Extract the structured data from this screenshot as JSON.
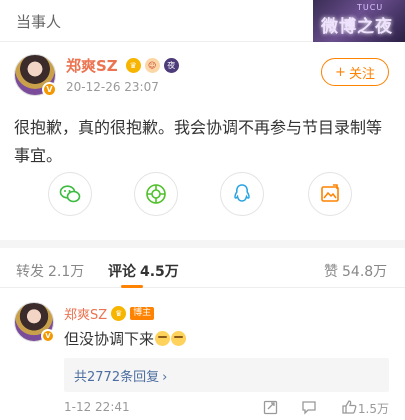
{
  "header": {
    "title": "当事人",
    "corner_small": "TUCU",
    "corner_big": "微博之夜"
  },
  "post": {
    "username": "郑爽SZ",
    "avatar_badge": "V",
    "tags": [
      "crown-icon",
      "face-icon",
      "night-icon"
    ],
    "night_tag": "夜",
    "timestamp": "20-12-26 23:07",
    "follow_label": "关注",
    "follow_plus": "+",
    "text": "很抱歉，真的很抱歉。我会协调不再参与节目录制等事宜。",
    "share_icons": [
      "wechat-icon",
      "moments-icon",
      "qq-icon",
      "image-share-icon"
    ]
  },
  "stats": {
    "repost_label": "转发",
    "repost_count": "2.1万",
    "comment_label": "评论",
    "comment_count": "4.5万",
    "like_label": "赞",
    "like_count": "54.8万"
  },
  "comment": {
    "username": "郑爽SZ",
    "author_badge": "博主",
    "text": "但没协调下来",
    "replies_label": "共2772条回复",
    "replies_chevron": "›",
    "timestamp": "1-12 22:41",
    "like_count": "1.5万"
  },
  "colors": {
    "accent": "#ff8200",
    "username": "#eb7350",
    "link": "#4d6ea0"
  }
}
